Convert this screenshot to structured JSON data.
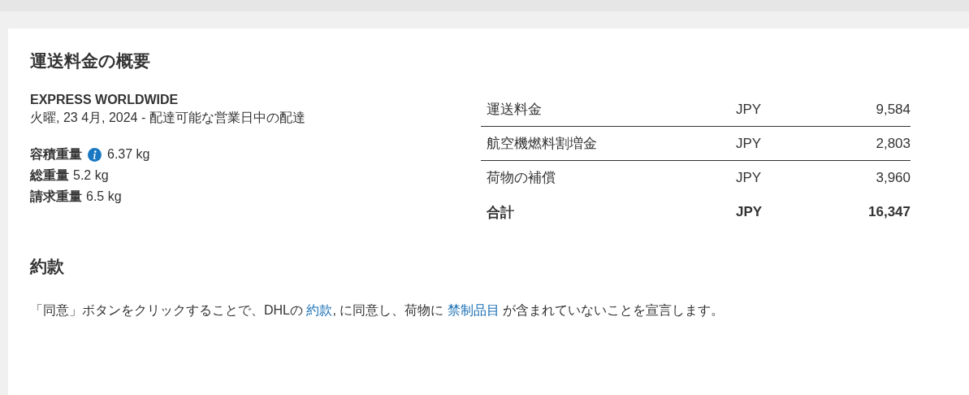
{
  "summary": {
    "title": "運送料金の概要",
    "service": "EXPRESS WORLDWIDE",
    "delivery": "火曜, 23 4月, 2024 - 配達可能な営業日中の配達",
    "weights": [
      {
        "label": "容積重量",
        "info": true,
        "value": "6.37 kg"
      },
      {
        "label": "総重量",
        "info": false,
        "value": "5.2 kg"
      },
      {
        "label": "請求重量",
        "info": false,
        "value": "6.5 kg"
      }
    ],
    "charges": [
      {
        "kind": "charge",
        "name": "運送料金",
        "currency": "JPY",
        "amount": "9,584"
      },
      {
        "kind": "charge",
        "name": "航空機燃料割増金",
        "currency": "JPY",
        "amount": "2,803"
      },
      {
        "kind": "charge",
        "name": "荷物の補償",
        "currency": "JPY",
        "amount": "3,960"
      },
      {
        "kind": "total",
        "name": "合計",
        "currency": "JPY",
        "amount": "16,347"
      }
    ]
  },
  "terms": {
    "title": "約款",
    "sentence": [
      {
        "kind": "text",
        "text": "「同意」ボタンをクリックすることで、DHLの "
      },
      {
        "kind": "link",
        "text": "約款"
      },
      {
        "kind": "text",
        "text": ", に同意し、荷物に "
      },
      {
        "kind": "link",
        "text": "禁制品目"
      },
      {
        "kind": "text",
        "text": " が含まれていないことを宣言します。"
      }
    ]
  }
}
